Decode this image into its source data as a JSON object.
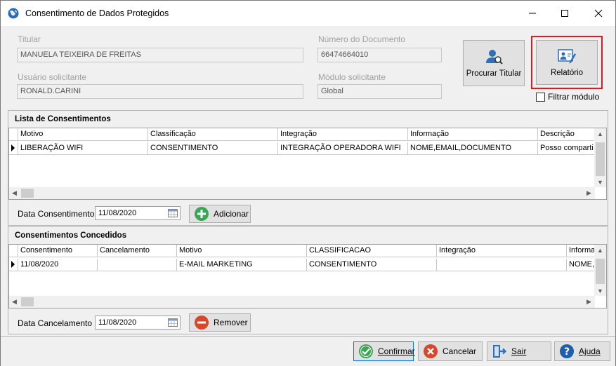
{
  "window": {
    "title": "Consentimento de Dados Protegidos"
  },
  "titular": {
    "label": "Titular",
    "value": "MANUELA TEIXEIRA DE FREITAS"
  },
  "documento": {
    "label": "Número do Documento",
    "value": "66474664010"
  },
  "usuario": {
    "label": "Usuário solicitante",
    "value": "RONALD.CARINI"
  },
  "modulo": {
    "label": "Módulo solicitante",
    "value": "Global"
  },
  "buttons": {
    "procurar": "Procurar Titular",
    "relatorio": "Relatório",
    "filtrar": "Filtrar módulo",
    "adicionar": "Adicionar",
    "remover": "Remover",
    "confirmar": "Confirmar",
    "cancelar": "Cancelar",
    "sair": "Sair",
    "ajuda": "Ajuda"
  },
  "lista": {
    "title": "Lista de Consentimentos",
    "columns": [
      "Motivo",
      "Classificação",
      "Integração",
      "Informação",
      "Descrição"
    ],
    "rows": [
      [
        "LIBERAÇÃO WIFI",
        "CONSENTIMENTO",
        "INTEGRAÇÃO OPERADORA WIFI",
        "NOME,EMAIL,DOCUMENTO",
        "Posso comparti"
      ]
    ],
    "date_label": "Data Consentimento",
    "date_value": "11/08/2020"
  },
  "concedidos": {
    "title": "Consentimentos Concedidos",
    "columns": [
      "Consentimento",
      "Cancelamento",
      "Motivo",
      "CLASSIFICACAO",
      "Integração",
      "Informa"
    ],
    "rows": [
      [
        "11/08/2020",
        "",
        "E-MAIL MARKETING",
        "CONSENTIMENTO",
        "",
        "NOME,E"
      ]
    ],
    "date_label": "Data Cancelamento",
    "date_value": "11/08/2020"
  },
  "colors": {
    "highlight": "#e01a22",
    "add_green": "#3aa655",
    "remove_red": "#d9472b",
    "help_blue": "#1f5ea8"
  },
  "icons": [
    "globe-icon",
    "minimize-icon",
    "maximize-icon",
    "close-icon",
    "search-user-icon",
    "report-edit-icon",
    "calendar-icon",
    "plus-circle-icon",
    "minus-circle-icon",
    "check-circle-icon",
    "x-circle-icon",
    "exit-door-icon",
    "help-icon"
  ]
}
